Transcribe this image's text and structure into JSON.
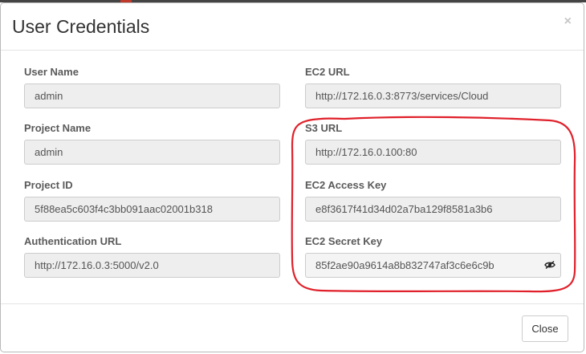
{
  "modal": {
    "title": "User Credentials",
    "close_glyph": "×",
    "close_button_label": "Close"
  },
  "left_fields": [
    {
      "label": "User Name",
      "value": "admin"
    },
    {
      "label": "Project Name",
      "value": "admin"
    },
    {
      "label": "Project ID",
      "value": "5f88ea5c603f4c3bb091aac02001b318"
    },
    {
      "label": "Authentication URL",
      "value": "http://172.16.0.3:5000/v2.0"
    }
  ],
  "right_fields": [
    {
      "label": "EC2 URL",
      "value": "http://172.16.0.3:8773/services/Cloud"
    },
    {
      "label": "S3 URL",
      "value": "http://172.16.0.100:80"
    },
    {
      "label": "EC2 Access Key",
      "value": "e8f3617f41d34d02a7ba129f8581a3b6"
    },
    {
      "label": "EC2 Secret Key",
      "value": "85f2ae90a9614a8b832747af3c6e6c9b"
    }
  ],
  "icons": {
    "secret_toggle": "eye-slash-icon",
    "dismiss": "close-icon"
  },
  "colors": {
    "highlight": "#e0202a",
    "input_bg": "#eeeeee",
    "label": "#5a5a5a"
  }
}
